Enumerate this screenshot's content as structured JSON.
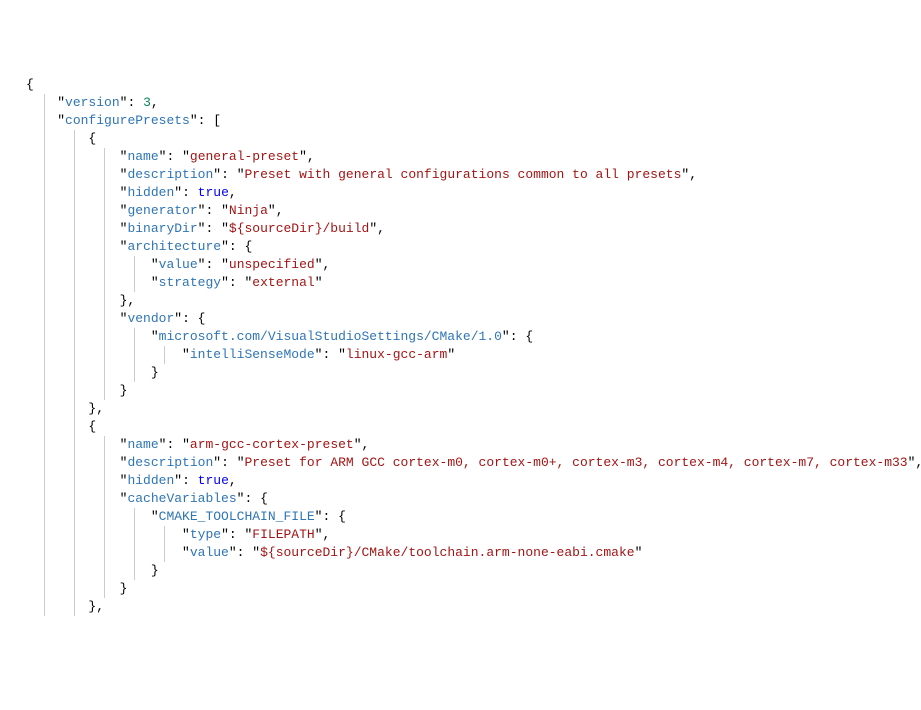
{
  "tokens": {
    "lbrace": "{",
    "rbrace": "}",
    "lbracket": "[",
    "rbracket": "]",
    "comma": ",",
    "colon": ":",
    "quote": "\""
  },
  "keys": {
    "version": "version",
    "configurePresets": "configurePresets",
    "name": "name",
    "description": "description",
    "hidden": "hidden",
    "generator": "generator",
    "binaryDir": "binaryDir",
    "architecture": "architecture",
    "value": "value",
    "strategy": "strategy",
    "vendor": "vendor",
    "msKey": "microsoft.com/VisualStudioSettings/CMake/1.0",
    "intelliSenseMode": "intelliSenseMode",
    "cacheVariables": "cacheVariables",
    "CMAKE_TOOLCHAIN_FILE": "CMAKE_TOOLCHAIN_FILE",
    "type": "type"
  },
  "values": {
    "versionNum": "3",
    "trueVal": "true",
    "p1_name": "general-preset",
    "p1_desc": "Preset with general configurations common to all presets",
    "p1_generator": "Ninja",
    "p1_binaryDir": "${sourceDir}/build",
    "p1_arch_value": "unspecified",
    "p1_arch_strategy": "external",
    "p1_intelliSense": "linux-gcc-arm",
    "p2_name": "arm-gcc-cortex-preset",
    "p2_desc": "Preset for ARM GCC cortex-m0, cortex-m0+, cortex-m3, cortex-m4, cortex-m7, cortex-m33",
    "p2_type": "FILEPATH",
    "p2_value": "${sourceDir}/CMake/toolchain.arm-none-eabi.cmake"
  }
}
